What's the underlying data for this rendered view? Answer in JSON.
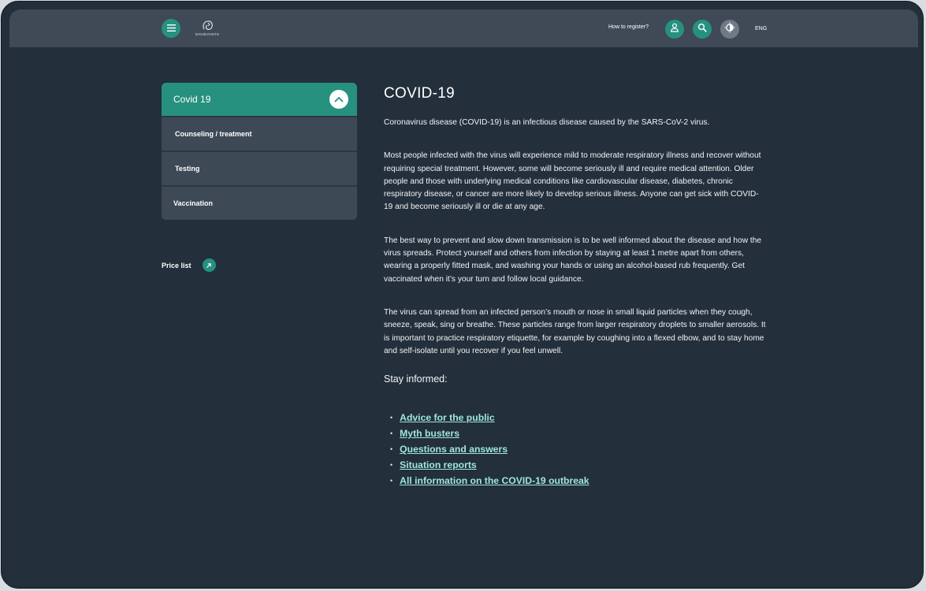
{
  "header": {
    "logo_text": "DAVIDYANTS",
    "register_link": "How to register?",
    "language": "ENG"
  },
  "icons": {
    "menu": "menu-icon",
    "user": "user-icon",
    "search": "search-icon",
    "theme": "theme-toggle-icon",
    "chevron": "chevron-up-icon",
    "arrow": "arrow-up-right-icon"
  },
  "sidebar": {
    "accordion_title": "Covid 19",
    "items": [
      {
        "label": "Counseling / treatment"
      },
      {
        "label": "Testing"
      },
      {
        "label": "Vaccination"
      }
    ],
    "price_list": "Price list"
  },
  "article": {
    "title": "COVID-19",
    "paragraphs": [
      "Coronavirus disease (COVID-19) is an infectious disease caused by the SARS-CoV-2 virus.",
      "Most people infected with the virus will experience mild to moderate respiratory illness and recover without requiring special treatment. However, some will become seriously ill and require medical attention. Older people and those with underlying medical conditions like cardiovascular disease, diabetes, chronic respiratory disease, or cancer are more likely to develop serious illness. Anyone can get sick with COVID-19 and become seriously ill or die at any age.",
      "The best way to prevent and slow down transmission is to be well informed about the disease and how the virus spreads. Protect yourself and others from infection by staying at least 1 metre apart from others, wearing a properly fitted mask, and washing your hands or using an alcohol-based rub frequently. Get vaccinated when it’s your turn and follow local guidance.",
      "The virus can spread from an infected person’s mouth or nose in small liquid particles when they cough, sneeze, speak, sing or breathe. These particles range from larger respiratory droplets to smaller aerosols. It is important to practice respiratory etiquette, for example by coughing into a flexed elbow, and to stay home and self-isolate until you recover if you feel unwell."
    ],
    "stay_informed": "Stay informed:",
    "links": [
      {
        "label": "Advice for the public "
      },
      {
        "label": "Myth busters "
      },
      {
        "label": "Questions and answers "
      },
      {
        "label": "Situation reports "
      },
      {
        "label": "All information on the COVID-19 outbreak "
      }
    ]
  },
  "colors": {
    "background": "#232f3b",
    "topbar": "#3f4a56",
    "accent": "#26917f",
    "link": "#9fe6da",
    "panel": "#3d4955"
  }
}
